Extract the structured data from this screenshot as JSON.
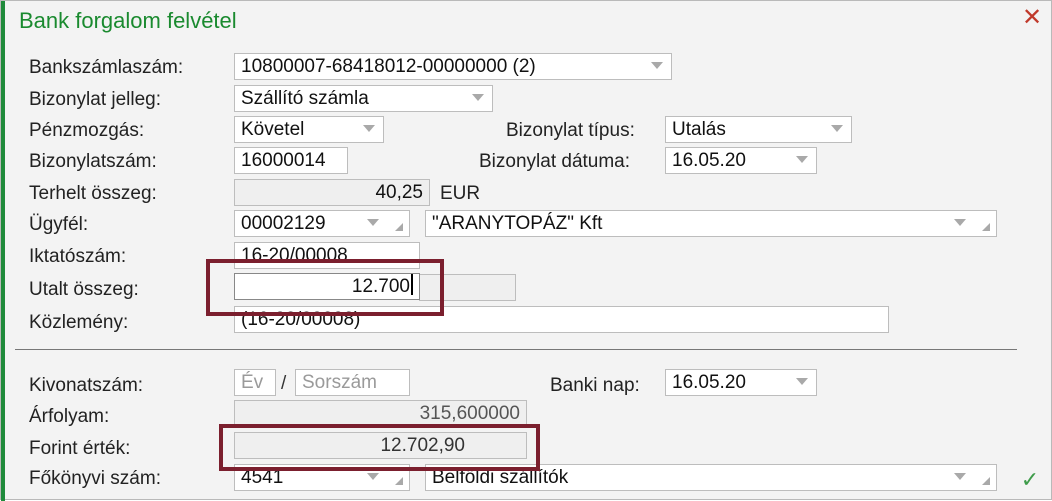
{
  "dialog": {
    "title": "Bank forgalom felvétel",
    "close_symbol": "✕",
    "confirm_symbol": "✓"
  },
  "form": {
    "bankszamlaszam": {
      "label": "Bankszámlaszám:",
      "value": "10800007-68418012-00000000 (2)"
    },
    "bizonylat_jelleg": {
      "label": "Bizonylat jelleg:",
      "value": "Szállító számla"
    },
    "penzmozgas": {
      "label": "Pénzmozgás:",
      "value": "Követel"
    },
    "bizonylat_tipus": {
      "label": "Bizonylat típus:",
      "value": "Utalás"
    },
    "bizonylatszam": {
      "label": "Bizonylatszám:",
      "value": "16000014"
    },
    "bizonylat_datuma": {
      "label": "Bizonylat dátuma:",
      "value": "16.05.20"
    },
    "terhelt_osszeg": {
      "label": "Terhelt összeg:",
      "value": "40,25",
      "currency": "EUR"
    },
    "ugyfel": {
      "label": "Ügyfél:",
      "code": "00002129",
      "name": "\"ARANYTOPÁZ\" Kft"
    },
    "iktatoszam": {
      "label": "Iktatószám:",
      "value": "16-20/00008"
    },
    "utalt_osszeg": {
      "label": "Utalt összeg:",
      "value": "12.700"
    },
    "kozlemeny": {
      "label": "Közlemény:",
      "value": "(16-20/00008)"
    }
  },
  "lower": {
    "kivonatszam": {
      "label": "Kivonatszám:",
      "ev_placeholder": "Év",
      "sorszam_placeholder": "Sorszám",
      "separator": "/"
    },
    "banki_nap": {
      "label": "Banki nap:",
      "value": "16.05.20"
    },
    "arfolyam": {
      "label": "Árfolyam:",
      "value": "315,600000"
    },
    "forint_ertek": {
      "label": "Forint érték:",
      "value": "12.702,90"
    },
    "fokonyvi_szam": {
      "label": "Főkönyvi szám:",
      "code": "4541",
      "name": "Belföldi szállítók"
    }
  },
  "colors": {
    "title": "#1a8a2f",
    "accent_bar": "#1f8a3b",
    "highlight_box": "#7b1f2e",
    "close": "#c0392b",
    "confirm": "#3e9c4a"
  }
}
